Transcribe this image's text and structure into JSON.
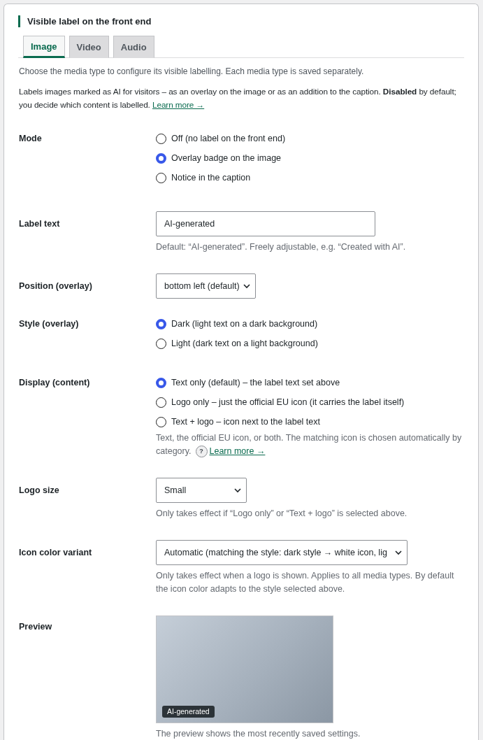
{
  "section": {
    "title": "Visible label on the front end"
  },
  "tabs": [
    {
      "label": "Image",
      "selected": true
    },
    {
      "label": "Video",
      "selected": false
    },
    {
      "label": "Audio",
      "selected": false
    }
  ],
  "intro": "Choose the media type to configure its visible labelling. Each media type is saved separately.",
  "description": "Labels images marked as AI for visitors – as an overlay on the image or as an addition to the caption. **Disabled** by default; you decide which content is labelled.",
  "description_link": "Learn more →",
  "fields": [
    {
      "kind": "radio",
      "label": "Mode",
      "options": [
        {
          "label": "Off (no label on the front end)",
          "selected": false
        },
        {
          "label": "Overlay badge on the image",
          "selected": true
        },
        {
          "label": "Notice in the caption",
          "selected": false
        }
      ]
    },
    {
      "kind": "text",
      "label": "Label text",
      "value": "AI-generated",
      "help": "Default: “AI-generated”. Freely adjustable, e.g. “Created with AI”."
    },
    {
      "kind": "select",
      "label": "Position (overlay)",
      "value": "bottom left (default)"
    },
    {
      "kind": "radio",
      "label": "Style (overlay)",
      "options": [
        {
          "label": "Dark (light text on a dark background)",
          "selected": true
        },
        {
          "label": "Light (dark text on a light background)",
          "selected": false
        }
      ]
    },
    {
      "kind": "radio",
      "label": "Display (content)",
      "options": [
        {
          "label": "Text only (default) – the label text set above",
          "selected": true
        },
        {
          "label": "Logo only – just the official EU icon (it carries the label itself)",
          "selected": false
        },
        {
          "label": "Text + logo – icon next to the label text",
          "selected": false
        }
      ],
      "help": "Text, the official EU icon, or both. The matching icon is chosen automatically by category.",
      "help_icon": "?",
      "help_link": "Learn more →"
    },
    {
      "kind": "select",
      "label": "Logo size",
      "value": "Small",
      "help": "Only takes effect if “Logo only” or “Text + logo” is selected above."
    },
    {
      "kind": "select",
      "label": "Icon color variant",
      "value": "Automatic (matching the style: dark style → white icon, lig",
      "help": "Only takes effect when a logo is shown. Applies to all media types. By default the icon color adapts to the style selected above."
    },
    {
      "kind": "preview",
      "label": "Preview",
      "badge": "AI-generated",
      "help": "The preview shows the most recently saved settings."
    }
  ]
}
